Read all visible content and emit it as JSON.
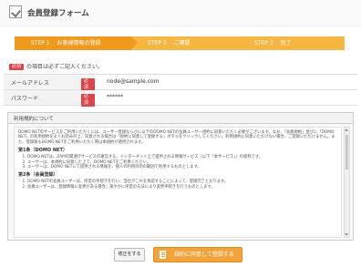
{
  "header": {
    "title": "会員登録フォーム"
  },
  "steps": [
    {
      "num": "STEP 1",
      "label": "お客様情報の登録",
      "state": "active"
    },
    {
      "num": "STEP 2",
      "label": "ご確認",
      "state": "inactive"
    },
    {
      "num": "STEP 3",
      "label": "完了",
      "state": "inactive"
    }
  ],
  "required_note": {
    "badge": "必須",
    "text": "の項目は必ずご記入ください。"
  },
  "form": {
    "rows": [
      {
        "label": "メールアドレス",
        "badge": "必須",
        "value": "node@sample.com"
      },
      {
        "label": "パスワード",
        "badge": "必須",
        "value": "******"
      }
    ]
  },
  "terms": {
    "heading": "利用規約について",
    "intro": "DOMO NETのサービスをご利用いただくには、ユーザー登録ならびに以下のDOMO NETの会員ユーザー規約に同意いただく必要がございます。なお、「会員規約」並びに「DOMO NET」の利用規約をよくお読みの上、同意される場合は「規約に同意して登録する」ボタンをクリックしてください。利用規約に同意いただけない場合、ご登録いただけません。また、登録後もDOMO NETをご利用いただく際は本規約が適用されます。",
    "section1_title": "第1条（DOMO NET）",
    "section1_items": [
      "DOMO NETは、ZAMの関連ITサービスの運営する、インターネット上で提供される情報サービス（以下「本サービス」）の総称です。",
      "ユーザーは、本規約に同意した上で、DOMO NETをご利用ください。",
      "ユーザーは、DOMO NETにて提供される情報を、個人の利用目的の範囲で利用するものとします。"
    ],
    "section2_title": "第2条（会員登録）",
    "section2_items": [
      "DOMO NETの会員ユーザーは、所定の手続きを行い、当社がこれを承認することによって、登録完了となります。",
      "会員ユーザーは、登録情報に変更がある場合、速やかに所定の方法により変更手続きを行うものとします。"
    ]
  },
  "buttons": {
    "back": "修正をする",
    "agree": "規約に同意して登録する"
  },
  "colors": {
    "accent": "#ef9a1c",
    "step_inactive": "#f5b642",
    "required": "#d9464c"
  }
}
